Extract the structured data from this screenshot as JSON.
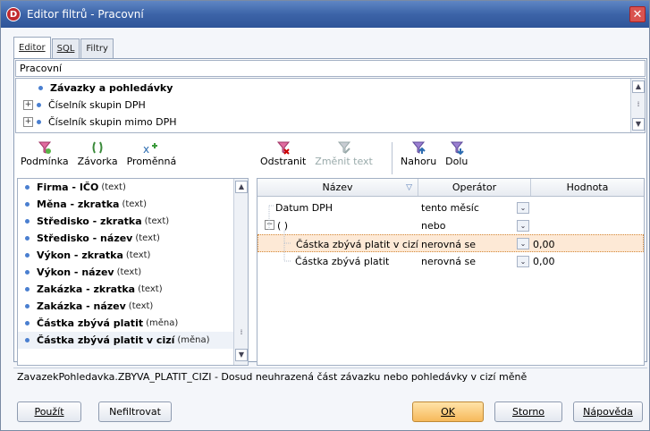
{
  "window": {
    "title": "Editor filtrů - Pracovní",
    "logo_letter": "D",
    "close_glyph": "✕"
  },
  "tabs": [
    {
      "label": "Editor",
      "active": true
    },
    {
      "label": "SQL",
      "active": false
    },
    {
      "label": "Filtry",
      "active": false
    }
  ],
  "filter_name": "Pracovní",
  "groups": [
    {
      "label": "Závazky a pohledávky",
      "bold": true,
      "expandable": false
    },
    {
      "label": "Číselník skupin DPH",
      "bold": false,
      "expandable": true
    },
    {
      "label": "Číselník skupin mimo DPH",
      "bold": false,
      "expandable": true
    }
  ],
  "toolbar": {
    "condition": "Podmínka",
    "bracket": "Závorka",
    "variable": "Proměnná",
    "remove": "Odstranit",
    "change_text": "Změnit text",
    "up": "Nahoru",
    "down": "Dolu"
  },
  "fields": [
    {
      "name": "Firma - IČO",
      "type": "(text)"
    },
    {
      "name": "Měna - zkratka",
      "type": "(text)"
    },
    {
      "name": "Středisko - zkratka",
      "type": "(text)"
    },
    {
      "name": "Středisko - název",
      "type": "(text)"
    },
    {
      "name": "Výkon - zkratka",
      "type": "(text)"
    },
    {
      "name": "Výkon - název",
      "type": "(text)"
    },
    {
      "name": "Zakázka - zkratka",
      "type": "(text)"
    },
    {
      "name": "Zakázka - název",
      "type": "(text)"
    },
    {
      "name": "Částka zbývá platit",
      "type": "(měna)"
    },
    {
      "name": "Částka zbývá platit v cizí",
      "type": "(měna)"
    }
  ],
  "grid": {
    "headers": {
      "name": "Název",
      "operator": "Operátor",
      "value": "Hodnota"
    },
    "rows": [
      {
        "name": "Datum DPH",
        "operator": "tento měsíc",
        "value": ""
      },
      {
        "name": "( )",
        "operator": "nebo",
        "value": "",
        "group": true
      },
      {
        "name": "Částka zbývá platit v cizí",
        "operator": "nerovná se",
        "value": "0,00"
      },
      {
        "name": "Částka zbývá platit",
        "operator": "nerovná se",
        "value": "0,00"
      }
    ]
  },
  "status": "ZavazekPohledavka.ZBYVA_PLATIT_CIZI - Dosud neuhrazená část závazku nebo pohledávky v cizí měně",
  "buttons": {
    "apply": "Použít",
    "unfilter": "Nefiltrovat",
    "ok": "OK",
    "cancel": "Storno",
    "help": "Nápověda"
  },
  "colors": {
    "titlebar": "#3c64a8",
    "accent_bullet": "#4a7fd0",
    "highlight_row": "#fde9d6",
    "ok_button": "#f6b95b"
  }
}
